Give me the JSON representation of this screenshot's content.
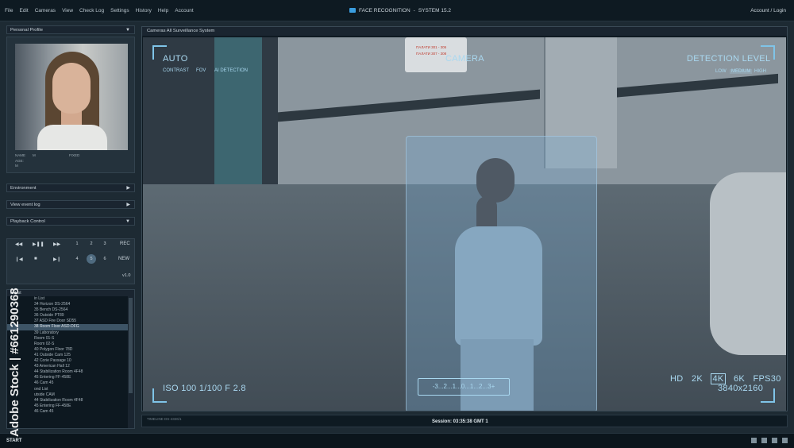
{
  "menu": [
    "File",
    "Edit",
    "Cameras",
    "View",
    "Check Log",
    "Settings",
    "History",
    "Help",
    "Account"
  ],
  "window_title": "FACE RECOGNITION",
  "system_version": "SYSTEM 15.2",
  "account_login": "Account / Login",
  "profile": {
    "header": "Personal Profile",
    "info_labels": [
      "NAME",
      "AGE:",
      "M"
    ],
    "info_col2": "M",
    "info_col3": "FIXED"
  },
  "panels": {
    "environment": "Environment",
    "event_log": "View event log",
    "playback": "Playback Control"
  },
  "playback": {
    "row1_numbers": [
      "1",
      "2",
      "3"
    ],
    "row1_action": "REC",
    "row2_numbers": [
      "4",
      "5",
      "6"
    ],
    "row2_action": "NEW",
    "selected": "5",
    "version": "v1.0"
  },
  "camera_list": {
    "header": "ra List",
    "items": [
      "in List",
      "34 Horizon DS-2564",
      "35 Bench DS-2564",
      "36 Outside PT89",
      "37 ASD Fire Door SD55",
      "38 Room Floor ASD-DFG",
      "39 Laboratory",
      "Room 01-S",
      "Room 02-S",
      "40 Polygon Floor 78D",
      "41 Outside Cam 125",
      "42 Corie Passage 10",
      "43 American Hall 12",
      "44 Stabilization Room 4F48",
      "45 Entering FF-458E",
      "46 Cam 45",
      "ond List",
      "utside CAM",
      "44 Stabilization Room 4F48",
      "45 Entering FF-458E",
      "46 Cam 45"
    ],
    "selected_index": 5
  },
  "feed": {
    "header": "Cameras All Surveillance System",
    "auto": "AUTO",
    "auto_options": [
      "CONTRAST",
      "FOV",
      "AI DETECTION"
    ],
    "camera_label": "CAMERA",
    "detection_title": "DETECTION LEVEL",
    "detection_levels": [
      "LOW",
      "MEDIUM",
      "HIGH"
    ],
    "exposure": "ISO 100 1/100 F 2.8",
    "resolutions": [
      "HD",
      "2K",
      "4K",
      "6K",
      "FPS30"
    ],
    "resolution_selected": "4K",
    "dimensions": "3840x2160",
    "scale": "-3...2...1...0...1...2...3+",
    "sign_lines": [
      "ПАЛАТИ 301 - 305",
      "ПАЛАТИ 307 - 308"
    ]
  },
  "session": "Session: 03:35:38 GMT 1",
  "timeline_text": "TIMELINE  DS-4326/1",
  "start": "START",
  "watermark": "Adobe Stock | #661290368",
  "colors": {
    "accent": "#a9d8f0",
    "selection": "#3d5466",
    "background": "#1d2a33"
  }
}
